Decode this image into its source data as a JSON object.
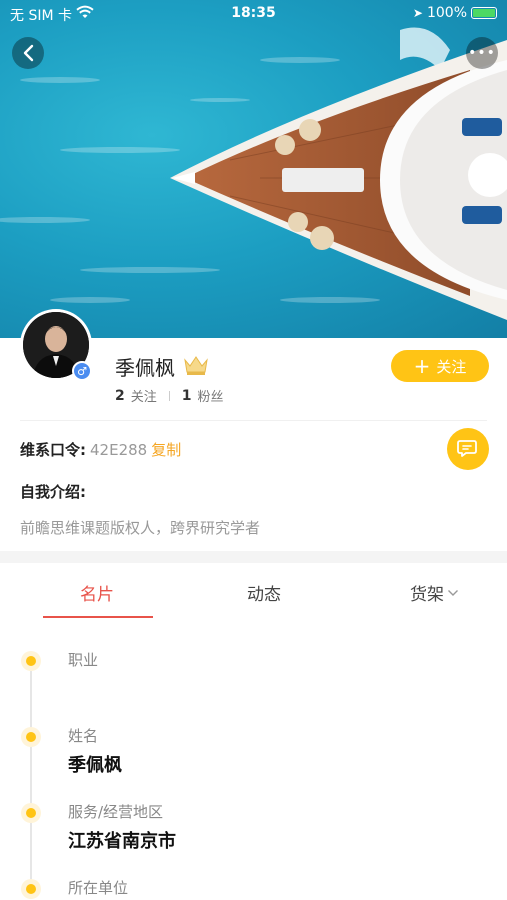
{
  "status_bar": {
    "carrier": "无 SIM 卡",
    "time": "18:35",
    "battery": "100%"
  },
  "header": {
    "back_icon": "chevron-left-icon",
    "more_icon": "ellipsis-icon"
  },
  "profile": {
    "name": "季佩枫",
    "gender_symbol": "♂",
    "following_count": "2",
    "following_label": "关注",
    "followers_count": "1",
    "followers_label": "粉丝",
    "follow_button": "关注",
    "follow_plus": "+"
  },
  "contact": {
    "label": "维系口令:",
    "code": "42E288",
    "copy": "复制"
  },
  "intro": {
    "title": "自我介绍:",
    "text": "前瞻思维课题版权人，跨界研究学者"
  },
  "tabs": [
    {
      "label": "名片",
      "active": true
    },
    {
      "label": "动态",
      "active": false
    },
    {
      "label": "货架",
      "active": false
    }
  ],
  "card_fields": [
    {
      "label": "职业",
      "value": ""
    },
    {
      "label": "姓名",
      "value": "季佩枫"
    },
    {
      "label": "服务/经营地区",
      "value": "江苏省南京市"
    },
    {
      "label": "所在单位",
      "value": ""
    }
  ],
  "colors": {
    "accent": "#ffc415",
    "tab_active": "#e8534a",
    "gender": "#4a8cf0"
  }
}
